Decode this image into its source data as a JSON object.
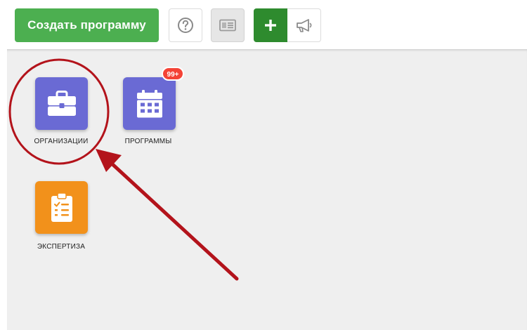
{
  "toolbar": {
    "create_program_label": "Создать программу",
    "help_icon": "question-circle-icon",
    "view_icon": "id-card-icon",
    "add_icon": "plus-icon",
    "announce_icon": "megaphone-icon"
  },
  "tiles": [
    {
      "label": "ОРГАНИЗАЦИИ",
      "icon": "briefcase-icon",
      "color": "#6a6ad4"
    },
    {
      "label": "ПРОГРАММЫ",
      "icon": "calendar-icon",
      "color": "#6a6ad4",
      "badge": "99+"
    },
    {
      "label": "ЭКСПЕРТИЗА",
      "icon": "clipboard-checklist-icon",
      "color": "#f2911b"
    }
  ],
  "colors": {
    "primary_green": "#4caf50",
    "dark_green": "#2e8b2e",
    "tile_purple": "#6a6ad4",
    "tile_orange": "#f2911b",
    "badge_red": "#f44336",
    "annotation_red": "#b3131b"
  }
}
